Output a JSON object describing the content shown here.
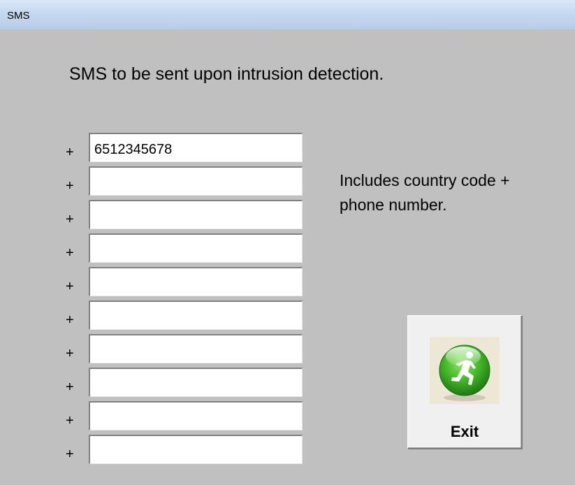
{
  "window": {
    "title": "SMS"
  },
  "heading": "SMS to be sent upon intrusion detection.",
  "phone_prefix": "+",
  "phone_numbers": [
    "6512345678",
    "",
    "",
    "",
    "",
    "",
    "",
    "",
    "",
    ""
  ],
  "hint": {
    "line1": "Includes country code +",
    "line2": "phone number."
  },
  "exit_button": {
    "label": "Exit",
    "icon": "running-man-icon"
  },
  "colors": {
    "window_background": "#c0c0c0",
    "titlebar": "#c5d8ef",
    "icon_green": "#3fb12c"
  }
}
